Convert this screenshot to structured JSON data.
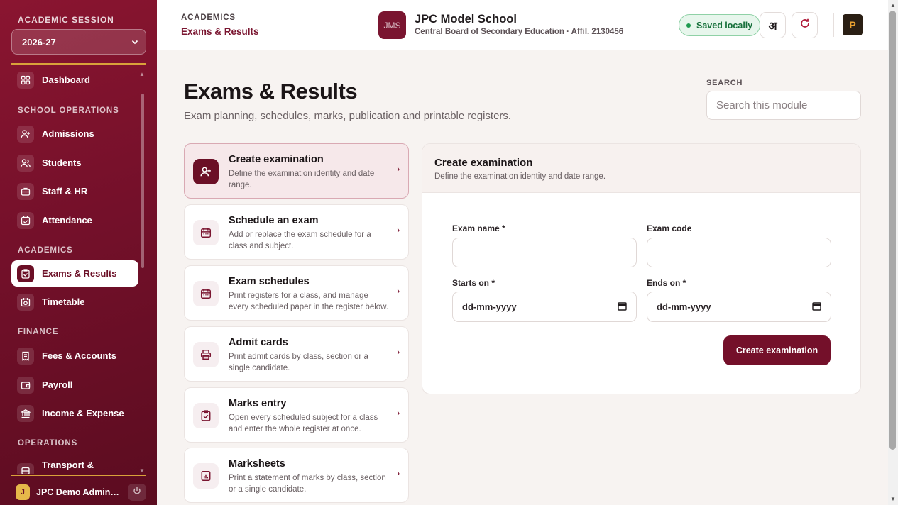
{
  "sidebar": {
    "session_label": "ACADEMIC SESSION",
    "session_value": "2026-27",
    "sections": {
      "school_ops": "SCHOOL OPERATIONS",
      "academics": "ACADEMICS",
      "finance": "FINANCE",
      "operations": "OPERATIONS"
    },
    "items": {
      "dashboard": "Dashboard",
      "admissions": "Admissions",
      "students": "Students",
      "staff": "Staff & HR",
      "attendance": "Attendance",
      "exams": "Exams & Results",
      "timetable": "Timetable",
      "fees": "Fees & Accounts",
      "payroll": "Payroll",
      "income": "Income & Expense",
      "transport": "Transport &"
    },
    "user": {
      "initial": "J",
      "name": "JPC Demo Administrator"
    }
  },
  "header": {
    "crumb_parent": "ACADEMICS",
    "crumb_current": "Exams & Results",
    "school_logo_text": "JMS",
    "school_name": "JPC Model School",
    "school_sub": "Central Board of Secondary Education · Affil. 2130456",
    "saved_status": "Saved locally",
    "lang_toggle": "अ",
    "brand_logo_text": "P"
  },
  "main": {
    "title": "Exams & Results",
    "subtitle": "Exam planning, schedules, marks, publication and printable registers.",
    "search_label": "SEARCH",
    "search_placeholder": "Search this module",
    "tasks": [
      {
        "title": "Create examination",
        "desc": "Define the examination identity and date range."
      },
      {
        "title": "Schedule an exam",
        "desc": "Add or replace the exam schedule for a class and subject."
      },
      {
        "title": "Exam schedules",
        "desc": "Print registers for a class, and manage every scheduled paper in the register below."
      },
      {
        "title": "Admit cards",
        "desc": "Print admit cards by class, section or a single candidate."
      },
      {
        "title": "Marks entry",
        "desc": "Open every scheduled subject for a class and enter the whole register at once."
      },
      {
        "title": "Marksheets",
        "desc": "Print a statement of marks by class, section or a single candidate."
      }
    ],
    "form": {
      "title": "Create examination",
      "subtitle": "Define the examination identity and date range.",
      "exam_name_label": "Exam name *",
      "exam_code_label": "Exam code",
      "starts_label": "Starts on *",
      "ends_label": "Ends on *",
      "date_placeholder": "dd-mm-yyyy",
      "submit": "Create examination"
    }
  },
  "colors": {
    "brand": "#74102a",
    "accent_gold": "#d9a23a",
    "saved_green": "#17703b"
  }
}
